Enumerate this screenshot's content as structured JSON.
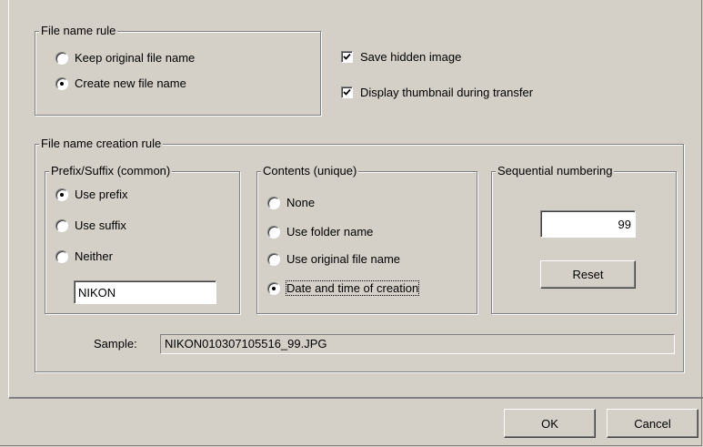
{
  "file_name_rule": {
    "legend": "File name rule",
    "options": [
      {
        "label": "Keep original file name",
        "selected": false
      },
      {
        "label": "Create new file name",
        "selected": true
      }
    ]
  },
  "checkboxes": [
    {
      "label": "Save hidden image",
      "checked": true
    },
    {
      "label": "Display thumbnail during transfer",
      "checked": true
    }
  ],
  "creation_rule": {
    "legend": "File name creation rule",
    "prefix_suffix": {
      "legend": "Prefix/Suffix (common)",
      "options": [
        {
          "label": "Use prefix",
          "selected": true
        },
        {
          "label": "Use suffix",
          "selected": false
        },
        {
          "label": "Neither",
          "selected": false
        }
      ],
      "text_value": "NIKON"
    },
    "contents": {
      "legend": "Contents (unique)",
      "options": [
        {
          "label": "None",
          "selected": false
        },
        {
          "label": "Use folder name",
          "selected": false
        },
        {
          "label": "Use original file name",
          "selected": false
        },
        {
          "label": "Date and time of creation",
          "selected": true
        }
      ]
    },
    "sequential": {
      "legend": "Sequential numbering",
      "value": "99",
      "reset_label": "Reset"
    },
    "sample": {
      "label": "Sample:",
      "value": "NIKON010307105516_99.JPG"
    }
  },
  "buttons": {
    "ok_label": "OK",
    "cancel_label": "Cancel"
  }
}
